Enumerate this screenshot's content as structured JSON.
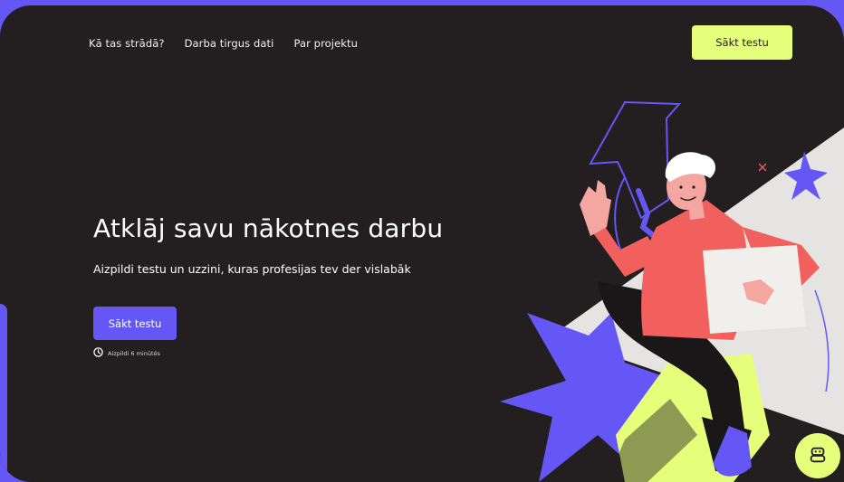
{
  "nav": {
    "items": [
      {
        "label": "Kā tas strādā?"
      },
      {
        "label": "Darba tirgus dati"
      },
      {
        "label": "Par projektu"
      }
    ],
    "cta_label": "Sākt testu"
  },
  "hero": {
    "title": "Atklāj savu nākotnes darbu",
    "subtitle": "Aizpildi testu un uzzini, kuras profesijas tev der vislabāk",
    "cta_label": "Sākt testu",
    "duration_text": "Aizpildi 6 minūtēs"
  },
  "icons": {
    "duration": "clock-icon",
    "chat": "robot-icon"
  },
  "colors": {
    "background": "#231f20",
    "accent": "#6557f5",
    "highlight": "#e6ff7a",
    "text": "#ffffff"
  }
}
